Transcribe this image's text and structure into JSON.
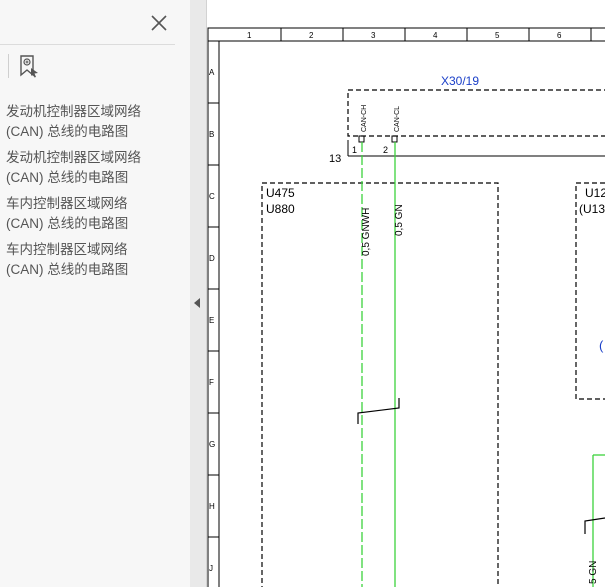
{
  "bookmarks": {
    "items": [
      {
        "line1": "发动机控制器区域网络",
        "line2": "(CAN) 总线的电路图"
      },
      {
        "line1": "发动机控制器区域网络",
        "line2": "(CAN) 总线的电路图"
      },
      {
        "line1": "车内控制器区域网络",
        "line2": "(CAN) 总线的电路图"
      },
      {
        "line1": "车内控制器区域网络",
        "line2": "(CAN) 总线的电路图"
      }
    ]
  },
  "drawing": {
    "columns": [
      "1",
      "2",
      "3",
      "4",
      "5",
      "6"
    ],
    "rows": [
      "A",
      "B",
      "C",
      "D",
      "E",
      "F",
      "G",
      "H",
      "J"
    ],
    "connector": {
      "id": "X30/19",
      "pin1_label": "CAN-CH",
      "pin2_label": "CAN-CL",
      "pin1": "1",
      "pin2": "2",
      "splice_number": "13"
    },
    "module_left": {
      "line1": "U475",
      "line2": "U880"
    },
    "module_right": {
      "line1": "U12",
      "line2": "(U13",
      "note": "("
    },
    "wire_left": "0,5 GNWH",
    "wire_right": "0,5 GN",
    "wire_far_right": "5 GN"
  }
}
